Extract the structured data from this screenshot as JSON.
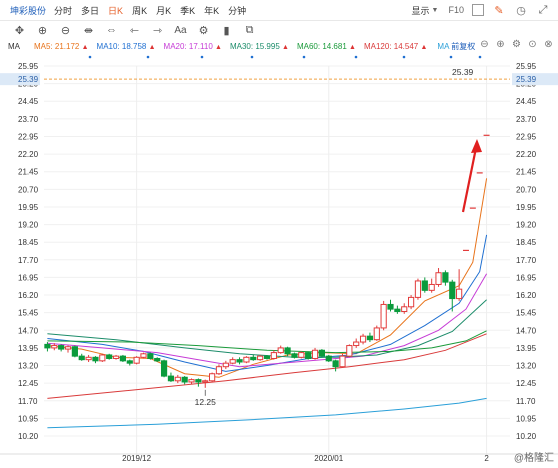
{
  "toolbar": {
    "symbol": "坤彩股份",
    "tabs": [
      {
        "label": "分时",
        "active": false
      },
      {
        "label": "多日",
        "active": false
      },
      {
        "label": "日K",
        "active": true
      },
      {
        "label": "周K",
        "active": false
      },
      {
        "label": "月K",
        "active": false
      },
      {
        "label": "季K",
        "active": false
      },
      {
        "label": "年K",
        "active": false
      },
      {
        "label": "分钟",
        "active": false
      }
    ],
    "display_label": "显示",
    "f10_label": "F10",
    "dropdown_icon": "chevron-down-icon",
    "icons": [
      "pencil-icon",
      "clock-icon",
      "expand-icon"
    ]
  },
  "tools": [
    "crosshair-icon",
    "zoom-in-icon",
    "zoom-out-icon",
    "pan-icon",
    "fit-icon",
    "back-icon",
    "forward-icon",
    "text-icon",
    "settings-icon",
    "candle-icon",
    "layers-icon"
  ],
  "ma_legend": {
    "label": "MA",
    "items": [
      {
        "name": "MA5",
        "value": "21.172",
        "color": "#e8731a"
      },
      {
        "name": "MA10",
        "value": "18.758",
        "color": "#1f6fd1"
      },
      {
        "name": "MA20",
        "value": "17.110",
        "color": "#c63bd6"
      },
      {
        "name": "MA30",
        "value": "15.995",
        "color": "#1c8c6a"
      },
      {
        "name": "MA60",
        "value": "14.681",
        "color": "#1a9a3a"
      },
      {
        "name": "MA120",
        "value": "14.547",
        "color": "#d93a3a"
      },
      {
        "name": "MA250",
        "value": "MA",
        "color": "#2a9fd8"
      }
    ],
    "fuquan": "前复权"
  },
  "chart_data": {
    "type": "candlestick",
    "ylim": [
      10.2,
      25.95
    ],
    "y_ticks": [
      "25.95",
      "25.20",
      "24.45",
      "23.70",
      "22.95",
      "22.20",
      "21.45",
      "20.70",
      "19.95",
      "19.20",
      "18.45",
      "17.70",
      "16.95",
      "16.20",
      "15.45",
      "14.70",
      "13.95",
      "13.20",
      "12.45",
      "11.70",
      "10.95",
      "10.20"
    ],
    "x_ticks": [
      "2019/12",
      "2020/01",
      "2"
    ],
    "current_price": "25.39",
    "current_price_label": "25.39",
    "low_annotation": "12.25",
    "candles": [
      [
        14.1,
        13.95,
        14.2,
        13.8
      ],
      [
        13.95,
        14.05,
        14.15,
        13.85
      ],
      [
        14.05,
        13.9,
        14.1,
        13.8
      ],
      [
        13.9,
        14.0,
        14.05,
        13.75
      ],
      [
        14.0,
        13.6,
        14.05,
        13.55
      ],
      [
        13.6,
        13.45,
        13.7,
        13.4
      ],
      [
        13.45,
        13.55,
        13.65,
        13.35
      ],
      [
        13.55,
        13.4,
        13.6,
        13.3
      ],
      [
        13.4,
        13.65,
        13.7,
        13.35
      ],
      [
        13.65,
        13.5,
        13.7,
        13.45
      ],
      [
        13.5,
        13.6,
        13.65,
        13.45
      ],
      [
        13.6,
        13.4,
        13.65,
        13.35
      ],
      [
        13.4,
        13.3,
        13.45,
        13.2
      ],
      [
        13.3,
        13.55,
        13.6,
        13.25
      ],
      [
        13.55,
        13.7,
        13.75,
        13.5
      ],
      [
        13.7,
        13.5,
        13.75,
        13.45
      ],
      [
        13.5,
        13.4,
        13.55,
        13.35
      ],
      [
        13.4,
        12.75,
        13.45,
        12.7
      ],
      [
        12.75,
        12.55,
        12.9,
        12.5
      ],
      [
        12.55,
        12.7,
        12.8,
        12.45
      ],
      [
        12.7,
        12.5,
        12.75,
        12.4
      ],
      [
        12.5,
        12.6,
        12.65,
        12.4
      ],
      [
        12.6,
        12.5,
        12.65,
        12.3
      ],
      [
        12.5,
        12.55,
        12.6,
        12.25
      ],
      [
        12.55,
        12.85,
        12.9,
        12.5
      ],
      [
        12.85,
        13.15,
        13.25,
        12.8
      ],
      [
        13.15,
        13.3,
        13.4,
        13.05
      ],
      [
        13.3,
        13.45,
        13.55,
        13.25
      ],
      [
        13.45,
        13.35,
        13.55,
        13.25
      ],
      [
        13.35,
        13.55,
        13.6,
        13.3
      ],
      [
        13.55,
        13.45,
        13.65,
        13.4
      ],
      [
        13.45,
        13.6,
        13.65,
        13.4
      ],
      [
        13.6,
        13.5,
        13.65,
        13.45
      ],
      [
        13.5,
        13.75,
        13.85,
        13.45
      ],
      [
        13.75,
        13.95,
        14.05,
        13.7
      ],
      [
        13.95,
        13.7,
        14.0,
        13.6
      ],
      [
        13.7,
        13.55,
        13.75,
        13.5
      ],
      [
        13.55,
        13.75,
        13.8,
        13.5
      ],
      [
        13.75,
        13.5,
        13.8,
        13.45
      ],
      [
        13.5,
        13.85,
        13.95,
        13.45
      ],
      [
        13.85,
        13.6,
        13.9,
        13.55
      ],
      [
        13.6,
        13.4,
        13.65,
        13.35
      ],
      [
        13.4,
        13.15,
        13.45,
        12.95
      ],
      [
        13.15,
        13.6,
        13.7,
        13.1
      ],
      [
        13.6,
        14.05,
        14.1,
        13.55
      ],
      [
        14.05,
        14.2,
        14.35,
        13.95
      ],
      [
        14.2,
        14.45,
        14.55,
        14.1
      ],
      [
        14.45,
        14.3,
        14.6,
        14.2
      ],
      [
        14.3,
        14.8,
        14.9,
        14.25
      ],
      [
        14.8,
        15.8,
        15.95,
        14.7
      ],
      [
        15.8,
        15.6,
        16.0,
        15.5
      ],
      [
        15.6,
        15.5,
        15.75,
        15.4
      ],
      [
        15.5,
        15.7,
        15.85,
        15.4
      ],
      [
        15.7,
        16.1,
        16.2,
        15.6
      ],
      [
        16.1,
        16.8,
        16.9,
        16.0
      ],
      [
        16.8,
        16.4,
        16.95,
        16.3
      ],
      [
        16.4,
        16.65,
        16.9,
        16.3
      ],
      [
        16.65,
        17.15,
        17.35,
        16.55
      ],
      [
        17.15,
        16.75,
        17.25,
        16.6
      ],
      [
        16.75,
        16.05,
        16.85,
        15.5
      ],
      [
        16.05,
        16.45,
        17.3,
        15.95
      ],
      [
        16.45,
        18.1,
        18.1,
        16.45
      ],
      [
        18.1,
        19.9,
        19.9,
        18.1
      ],
      [
        19.9,
        21.4,
        21.4,
        19.9
      ],
      [
        21.4,
        23.0,
        23.0,
        21.4
      ]
    ],
    "ma_lines": [
      {
        "name": "MA5",
        "color": "#e8731a",
        "points": [
          [
            0,
            14.05
          ],
          [
            5,
            13.9
          ],
          [
            10,
            13.55
          ],
          [
            15,
            13.5
          ],
          [
            20,
            12.85
          ],
          [
            25,
            12.7
          ],
          [
            30,
            13.25
          ],
          [
            35,
            13.65
          ],
          [
            40,
            13.75
          ],
          [
            45,
            13.7
          ],
          [
            50,
            14.5
          ],
          [
            55,
            15.95
          ],
          [
            60,
            16.6
          ],
          [
            62,
            17.6
          ],
          [
            64,
            21.17
          ]
        ]
      },
      {
        "name": "MA10",
        "color": "#1f6fd1",
        "points": [
          [
            0,
            14.35
          ],
          [
            8,
            14.1
          ],
          [
            14,
            13.8
          ],
          [
            20,
            13.35
          ],
          [
            26,
            12.95
          ],
          [
            32,
            13.2
          ],
          [
            38,
            13.5
          ],
          [
            44,
            13.65
          ],
          [
            50,
            14.1
          ],
          [
            55,
            14.9
          ],
          [
            60,
            15.85
          ],
          [
            63,
            17.2
          ],
          [
            64,
            18.76
          ]
        ]
      },
      {
        "name": "MA20",
        "color": "#c63bd6",
        "points": [
          [
            0,
            14.15
          ],
          [
            8,
            13.95
          ],
          [
            16,
            13.75
          ],
          [
            22,
            13.45
          ],
          [
            28,
            13.15
          ],
          [
            34,
            13.3
          ],
          [
            40,
            13.45
          ],
          [
            46,
            13.6
          ],
          [
            52,
            14.05
          ],
          [
            57,
            14.7
          ],
          [
            61,
            15.6
          ],
          [
            64,
            17.11
          ]
        ]
      },
      {
        "name": "MA30",
        "color": "#1c8c6a",
        "points": [
          [
            0,
            14.55
          ],
          [
            10,
            14.3
          ],
          [
            20,
            13.95
          ],
          [
            28,
            13.7
          ],
          [
            36,
            13.55
          ],
          [
            42,
            13.55
          ],
          [
            48,
            13.65
          ],
          [
            54,
            14.05
          ],
          [
            59,
            14.65
          ],
          [
            64,
            16.0
          ]
        ]
      },
      {
        "name": "MA60",
        "color": "#1a9a3a",
        "points": [
          [
            0,
            14.25
          ],
          [
            12,
            14.2
          ],
          [
            22,
            14.05
          ],
          [
            32,
            13.85
          ],
          [
            42,
            13.75
          ],
          [
            50,
            13.8
          ],
          [
            56,
            13.95
          ],
          [
            61,
            14.25
          ],
          [
            64,
            14.68
          ]
        ]
      },
      {
        "name": "MA120",
        "color": "#d93a3a",
        "points": [
          [
            0,
            11.8
          ],
          [
            14,
            12.2
          ],
          [
            26,
            12.55
          ],
          [
            36,
            12.9
          ],
          [
            44,
            13.15
          ],
          [
            52,
            13.45
          ],
          [
            58,
            13.85
          ],
          [
            64,
            14.55
          ]
        ]
      },
      {
        "name": "MA250",
        "color": "#2a9fd8",
        "points": [
          [
            0,
            10.55
          ],
          [
            16,
            10.7
          ],
          [
            30,
            10.9
          ],
          [
            42,
            11.1
          ],
          [
            52,
            11.35
          ],
          [
            60,
            11.6
          ],
          [
            64,
            11.8
          ]
        ]
      }
    ]
  },
  "watermark": "@格隆汇"
}
